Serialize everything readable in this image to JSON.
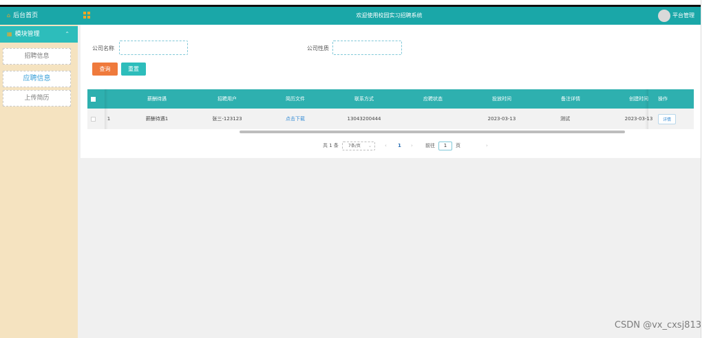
{
  "sidebar": {
    "home_label": "后台首页",
    "group_label": "模块管理",
    "items": [
      {
        "label": "招聘信息"
      },
      {
        "label": "应聘信息"
      },
      {
        "label": "上传简历"
      }
    ]
  },
  "header": {
    "title": "欢迎使用校园实习招聘系统",
    "user_name": "平台管理"
  },
  "search": {
    "company_name_label": "公司名称",
    "company_name_value": "",
    "company_type_label": "公司性质",
    "company_type_value": "",
    "search_button": "查询",
    "reset_button": "重置"
  },
  "table": {
    "columns": [
      "薪酬待遇",
      "招聘用户",
      "简历文件",
      "联系方式",
      "应聘状态",
      "投放时间",
      "备注详情",
      "创建时间",
      "操作"
    ],
    "rows": [
      {
        "index": "1",
        "salary": "薪酬待遇1",
        "recruiter": "张三-123123",
        "resume": "点击下载",
        "contact": "13043200444",
        "status": "",
        "post_time": "2023-03-13",
        "remark": "测试",
        "created": "2023-03-13",
        "action": "详情"
      }
    ]
  },
  "pager": {
    "total": "共 1 条",
    "page_size": "7条/页",
    "prev": "‹",
    "current": "1",
    "next": "›",
    "goto_label": "前往",
    "goto_value": "1",
    "goto_unit": "页"
  },
  "watermark": "CSDN @vx_cxsj813",
  "colors": {
    "teal": "#1aa7a8",
    "sidebar_bg": "#f5e3c0",
    "search_button": "#ef7a3c",
    "reset_button": "#2dbdbb"
  }
}
